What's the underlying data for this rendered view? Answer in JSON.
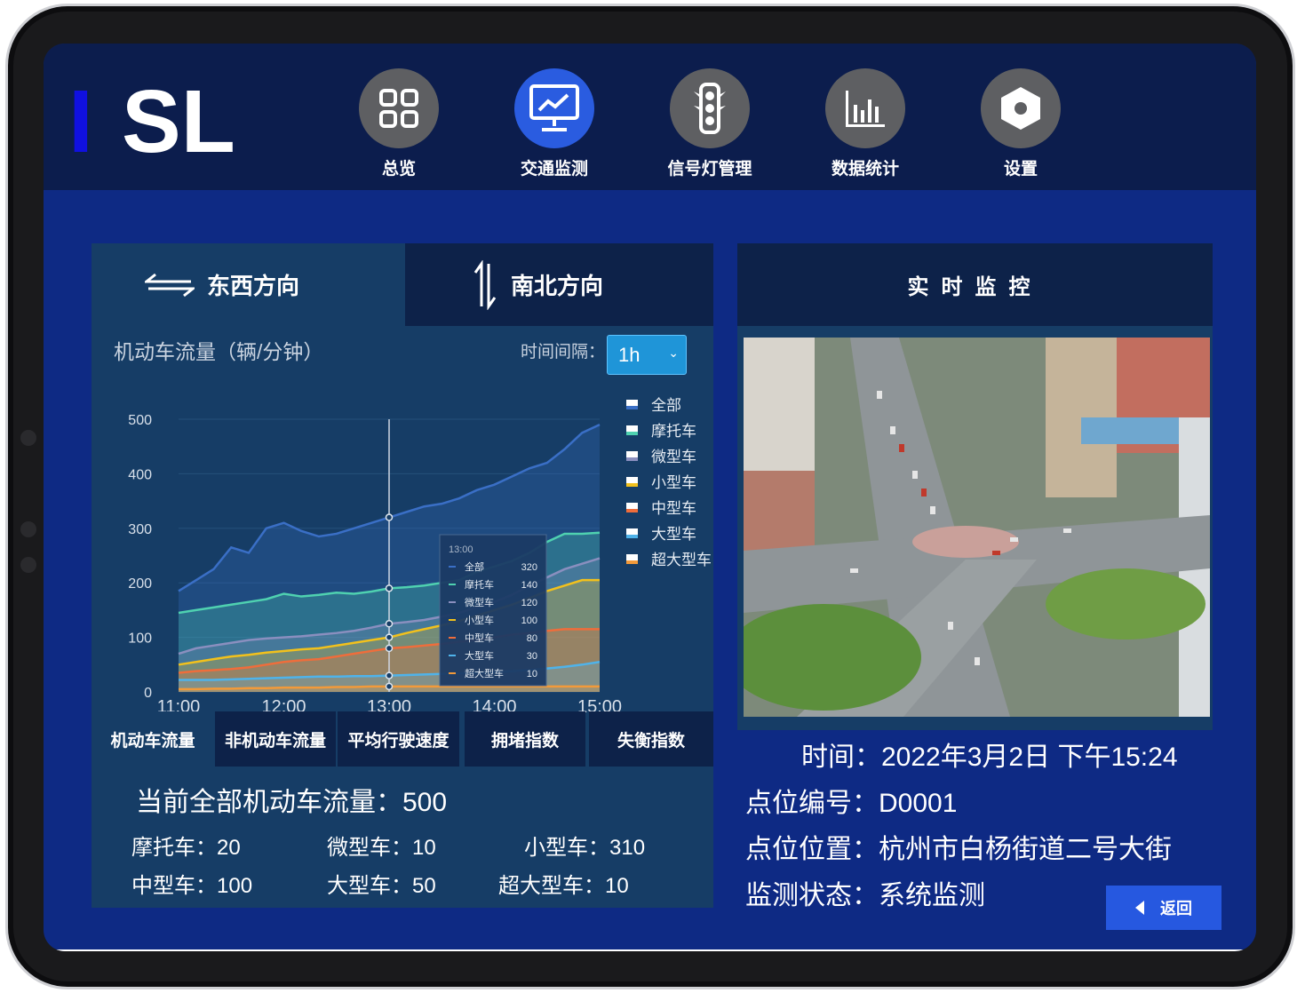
{
  "brand": {
    "logo_text": "ISL",
    "logo_color_i": "#1010e0",
    "logo_color_sl": "#ffffff"
  },
  "nav": [
    {
      "label": "总览",
      "icon": "grid-icon"
    },
    {
      "label": "交通监测",
      "icon": "monitor-chart-icon",
      "active": true
    },
    {
      "label": "信号灯管理",
      "icon": "traffic-light-icon"
    },
    {
      "label": "数据统计",
      "icon": "bar-chart-icon"
    },
    {
      "label": "设置",
      "icon": "hexagon-settings-icon"
    }
  ],
  "direction_tabs": {
    "east_west": "东西方向",
    "north_south": "南北方向",
    "active": "east_west"
  },
  "chart_panel": {
    "title": "机动车流量（辆/分钟）",
    "interval_label": "时间间隔：",
    "interval_value": "1h"
  },
  "chart_data": {
    "type": "area",
    "x": [
      "11:00",
      "11:10",
      "11:20",
      "11:30",
      "11:40",
      "11:50",
      "12:00",
      "12:10",
      "12:20",
      "12:30",
      "12:40",
      "12:50",
      "13:00",
      "13:10",
      "13:20",
      "13:30",
      "13:40",
      "13:50",
      "14:00",
      "14:10",
      "14:20",
      "14:30",
      "14:40",
      "14:50",
      "15:00"
    ],
    "xticks": [
      "11:00",
      "12:00",
      "13:00",
      "14:00",
      "15:00"
    ],
    "ylim": [
      0,
      500
    ],
    "yticks": [
      0,
      100,
      200,
      300,
      400,
      500
    ],
    "series": [
      {
        "name": "全部",
        "color": "#3a6fc6",
        "values": [
          185,
          205,
          225,
          265,
          255,
          300,
          310,
          295,
          285,
          290,
          300,
          310,
          320,
          330,
          340,
          345,
          355,
          370,
          380,
          395,
          410,
          420,
          445,
          475,
          490
        ]
      },
      {
        "name": "摩托车",
        "color": "#4fd1b0",
        "values": [
          145,
          150,
          155,
          160,
          165,
          170,
          180,
          175,
          178,
          182,
          180,
          184,
          190,
          192,
          195,
          200,
          205,
          220,
          230,
          240,
          255,
          275,
          290,
          290,
          292
        ]
      },
      {
        "name": "微型车",
        "color": "#8a8fbf",
        "values": [
          70,
          80,
          85,
          90,
          95,
          98,
          100,
          102,
          105,
          108,
          112,
          118,
          125,
          128,
          132,
          138,
          145,
          155,
          165,
          178,
          195,
          210,
          225,
          235,
          245
        ]
      },
      {
        "name": "小型车",
        "color": "#f2c11c",
        "values": [
          50,
          55,
          60,
          65,
          68,
          72,
          75,
          78,
          80,
          85,
          90,
          95,
          100,
          108,
          115,
          122,
          130,
          140,
          150,
          160,
          172,
          185,
          195,
          205,
          205
        ]
      },
      {
        "name": "中型车",
        "color": "#ef6d3b",
        "values": [
          35,
          38,
          40,
          42,
          45,
          50,
          55,
          58,
          60,
          65,
          70,
          75,
          80,
          82,
          85,
          88,
          92,
          95,
          100,
          105,
          108,
          112,
          115,
          115,
          115
        ]
      },
      {
        "name": "大型车",
        "color": "#4fb3ea",
        "values": [
          22,
          22,
          22,
          23,
          24,
          25,
          26,
          27,
          28,
          28,
          29,
          29,
          30,
          31,
          32,
          33,
          34,
          35,
          36,
          38,
          40,
          43,
          46,
          50,
          55
        ]
      },
      {
        "name": "超大型车",
        "color": "#f29a3a",
        "values": [
          5,
          5,
          6,
          6,
          7,
          7,
          8,
          8,
          8,
          9,
          9,
          10,
          10,
          10,
          10,
          10,
          10,
          10,
          10,
          10,
          10,
          10,
          10,
          10,
          10
        ]
      }
    ],
    "tooltip": {
      "time": "13:00",
      "rows": [
        {
          "name": "全部",
          "value": "320"
        },
        {
          "name": "摩托车",
          "value": "140"
        },
        {
          "name": "微型车",
          "value": "120"
        },
        {
          "name": "小型车",
          "value": "100"
        },
        {
          "name": "中型车",
          "value": "80"
        },
        {
          "name": "大型车",
          "value": "30"
        },
        {
          "name": "超大型车",
          "value": "10"
        }
      ]
    },
    "legend_position": "right"
  },
  "metric_tabs": [
    {
      "label": "机动车流量",
      "active": true
    },
    {
      "label": "非机动车流量"
    },
    {
      "label": "平均行驶速度"
    },
    {
      "label": "拥堵指数"
    },
    {
      "label": "失衡指数"
    }
  ],
  "stats": {
    "total": "当前全部机动车流量：500",
    "motorcycle": "摩托车：20",
    "mini": "微型车：10",
    "small": "小型车：310",
    "medium": "中型车：100",
    "large": "大型车：50",
    "xlarge": "超大型车：10"
  },
  "monitor": {
    "header": "实时监控",
    "time": "时间：2022年3月2日 下午15:24",
    "point_id": "点位编号：D0001",
    "point_location": "点位位置：杭州市白杨街道二号大街",
    "status": "监测状态：系统监测",
    "back_label": "返回"
  }
}
